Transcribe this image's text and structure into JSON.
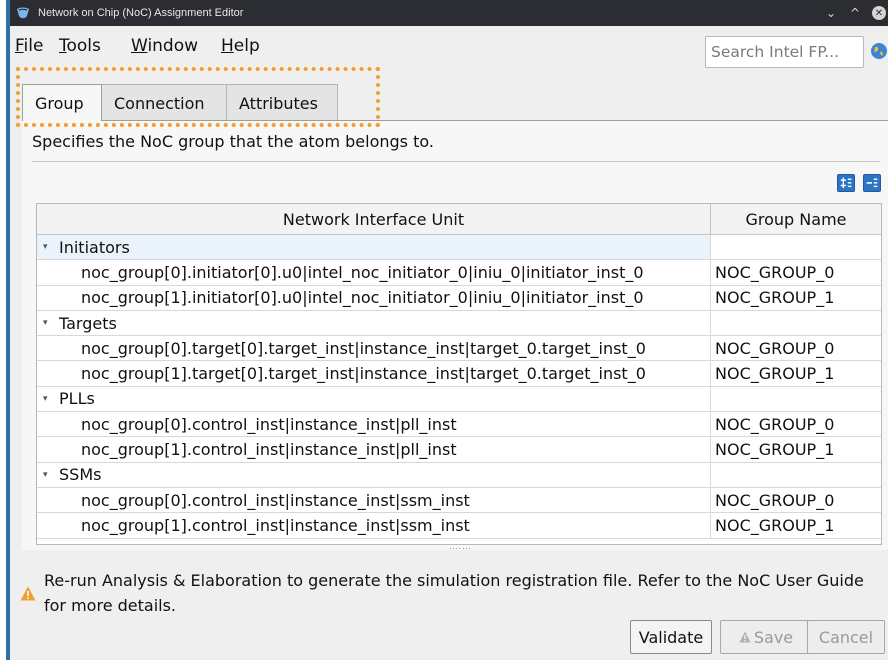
{
  "window": {
    "title": "Network on Chip (NoC) Assignment Editor",
    "controls": [
      "chevron-down",
      "chevron-up",
      "close"
    ]
  },
  "menu": [
    {
      "mnemonic": "F",
      "rest": "ile"
    },
    {
      "mnemonic": "T",
      "rest": "ools"
    },
    {
      "mnemonic": "W",
      "rest": "indow"
    },
    {
      "mnemonic": "H",
      "rest": "elp"
    }
  ],
  "search": {
    "placeholder": "Search Intel FP..."
  },
  "tabs": [
    {
      "label": "Group",
      "active": true
    },
    {
      "label": "Connection",
      "active": false
    },
    {
      "label": "Attributes",
      "active": false
    }
  ],
  "panel": {
    "description": "Specifies the NoC group that the atom belongs to."
  },
  "table": {
    "columns": [
      "Network Interface Unit",
      "Group Name"
    ],
    "groups": [
      {
        "name": "Initiators",
        "rows": [
          {
            "niu": "noc_group[0].initiator[0].u0|intel_noc_initiator_0|iniu_0|initiator_inst_0",
            "group": "NOC_GROUP_0"
          },
          {
            "niu": "noc_group[1].initiator[0].u0|intel_noc_initiator_0|iniu_0|initiator_inst_0",
            "group": "NOC_GROUP_1"
          }
        ]
      },
      {
        "name": "Targets",
        "rows": [
          {
            "niu": "noc_group[0].target[0].target_inst|instance_inst|target_0.target_inst_0",
            "group": "NOC_GROUP_0"
          },
          {
            "niu": "noc_group[1].target[0].target_inst|instance_inst|target_0.target_inst_0",
            "group": "NOC_GROUP_1"
          }
        ]
      },
      {
        "name": "PLLs",
        "rows": [
          {
            "niu": "noc_group[0].control_inst|instance_inst|pll_inst",
            "group": "NOC_GROUP_0"
          },
          {
            "niu": "noc_group[1].control_inst|instance_inst|pll_inst",
            "group": "NOC_GROUP_1"
          }
        ]
      },
      {
        "name": "SSMs",
        "rows": [
          {
            "niu": "noc_group[0].control_inst|instance_inst|ssm_inst",
            "group": "NOC_GROUP_0"
          },
          {
            "niu": "noc_group[1].control_inst|instance_inst|ssm_inst",
            "group": "NOC_GROUP_1"
          }
        ]
      }
    ]
  },
  "warning": {
    "text": "Re-run Analysis & Elaboration to generate the simulation registration file. Refer to the NoC User Guide for more details.",
    "color": "#f0a030"
  },
  "buttons": {
    "validate": "Validate",
    "save": "Save",
    "cancel": "Cancel"
  },
  "colors": {
    "titlebar": "#2b2d33",
    "accent": "#2e74c4",
    "focus": "#f0a030"
  }
}
